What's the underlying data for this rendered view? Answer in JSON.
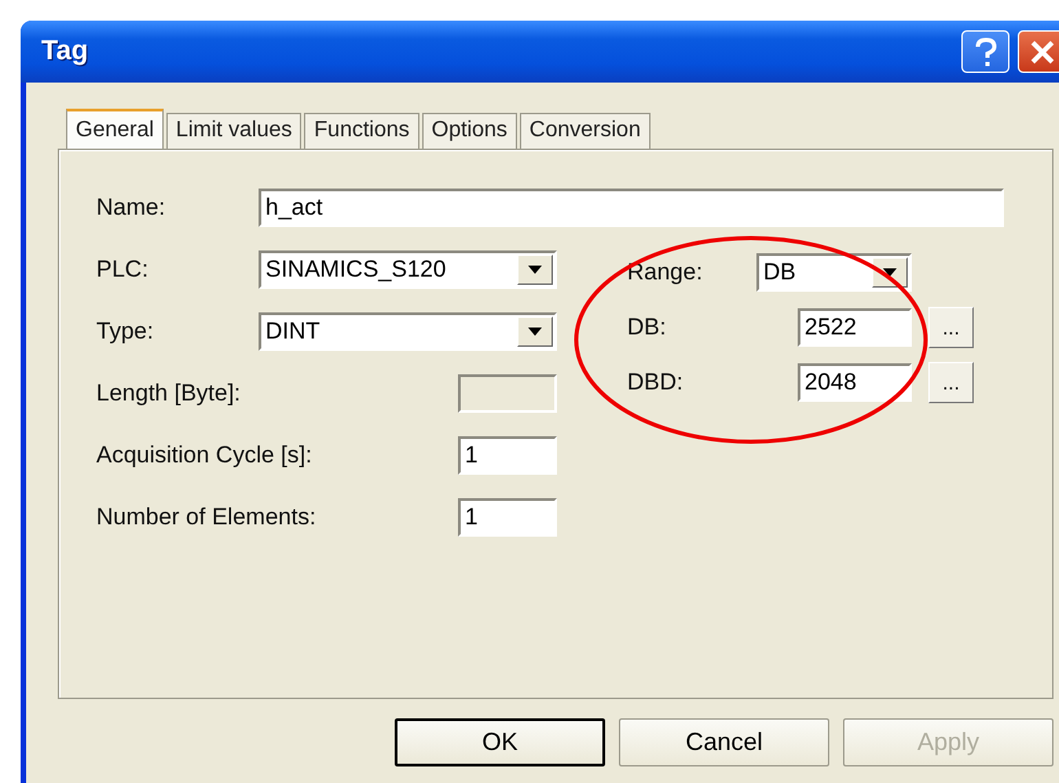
{
  "window": {
    "title": "Tag"
  },
  "tabs": [
    {
      "label": "General",
      "selected": true
    },
    {
      "label": "Limit values",
      "selected": false
    },
    {
      "label": "Functions",
      "selected": false
    },
    {
      "label": "Options",
      "selected": false
    },
    {
      "label": "Conversion",
      "selected": false
    }
  ],
  "name_field": {
    "label": "Name:",
    "value": "h_act"
  },
  "left_fields": [
    {
      "kind": "dropdown",
      "label": "PLC:",
      "value": "SINAMICS_S120"
    },
    {
      "kind": "dropdown",
      "label": "Type:",
      "value": "DINT"
    },
    {
      "kind": "input",
      "label": "Length [Byte]:",
      "disabled": true
    },
    {
      "kind": "input",
      "label": "Acquisition Cycle [s]:",
      "value": "1",
      "disabled": false
    },
    {
      "kind": "input",
      "label": "Number of Elements:",
      "value": "1",
      "disabled": false
    }
  ],
  "address_fields": [
    {
      "kind": "dropdown",
      "label": "Range:",
      "value": "DB"
    },
    {
      "kind": "browse",
      "label": "DB:",
      "value": "2522",
      "button": "..."
    },
    {
      "kind": "browse",
      "label": "DBD:",
      "value": "2048",
      "button": "..."
    }
  ],
  "buttons": [
    {
      "label": "OK",
      "focused": true,
      "disabled": false
    },
    {
      "label": "Cancel",
      "focused": false,
      "disabled": false
    },
    {
      "label": "Apply",
      "focused": false,
      "disabled": true
    }
  ]
}
